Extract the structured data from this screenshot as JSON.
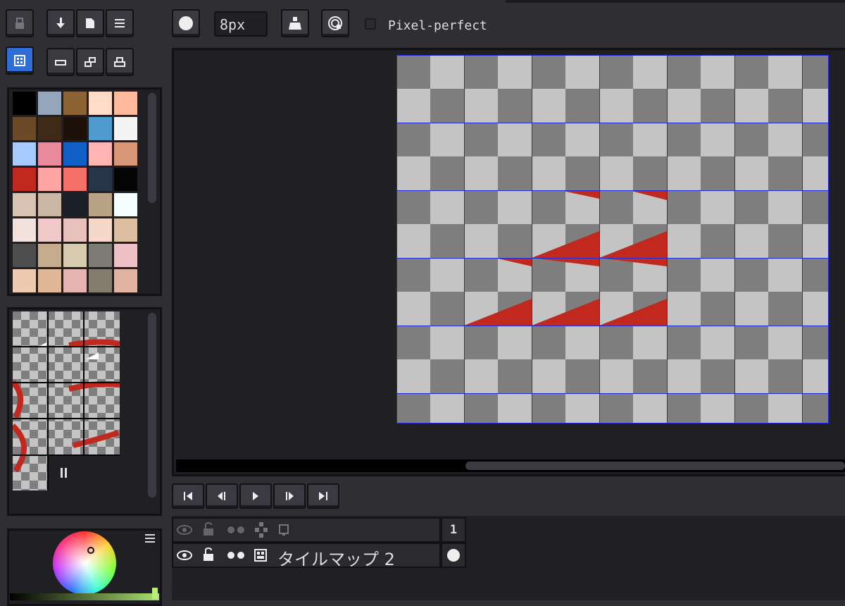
{
  "toolbar": {
    "brush_size": "8px",
    "pixel_perfect_label": "Pixel-perfect",
    "pixel_perfect_checked": false
  },
  "palette": {
    "colors": [
      "#000000",
      "#94a5bc",
      "#8c6433",
      "#ffdcc8",
      "#ffb99c",
      "#6b4a28",
      "#3e2a16",
      "#1c1008",
      "#4f9bd0",
      "#f4f4f4",
      "#a8cbff",
      "#e88a9c",
      "#1160c8",
      "#ffb4b4",
      "#d89878",
      "#c1281e",
      "#ffa4a4",
      "#f57069",
      "#283449",
      "#050505",
      "#d8c3b0",
      "#c9b6a3",
      "#1a1f28",
      "#b8a384",
      "#f4fdff",
      "#f3e2dc",
      "#f0c8c8",
      "#e8c0bc",
      "#f6d8c8",
      "#dcbea0",
      "#4e4e4e",
      "#c4ac8c",
      "#d8ccb0",
      "#7c7c74",
      "#ecc0c4",
      "#eecab0",
      "#e0b898",
      "#e4b4b0",
      "#847c6c",
      "#e0b4a0"
    ]
  },
  "timeline": {
    "frame_number": "1",
    "layer_name": "タイルマップ 2"
  },
  "icons": {
    "lock": "lock-icon",
    "download": "download-icon",
    "file": "file-icon",
    "menu": "menu-icon",
    "tile": "tile-icon",
    "eye": "eye-icon",
    "onion": "onion-skin-icon"
  },
  "colors": {
    "accent": "#2f6ed6",
    "grid_line": "#1f2bd6",
    "checker_dark": "#7f7f7f",
    "checker_light": "#c4c4c4",
    "stroke": "#c1281e"
  }
}
